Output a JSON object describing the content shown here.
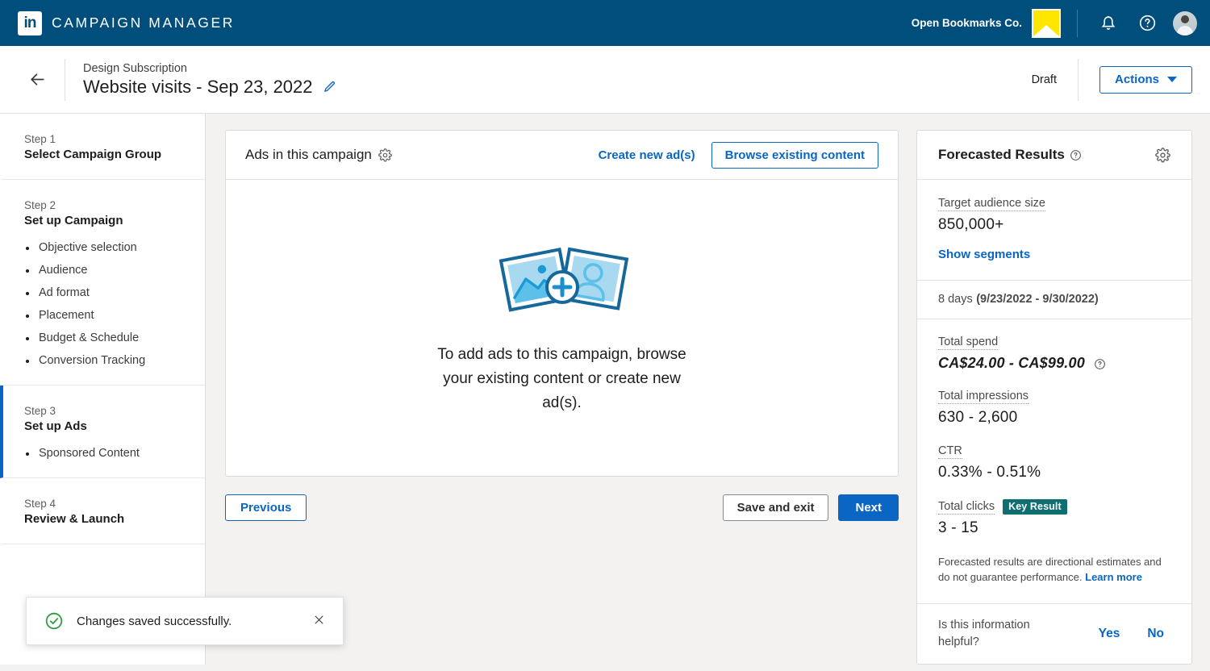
{
  "topnav": {
    "logo_text": "in",
    "brand": "CAMPAIGN MANAGER",
    "account_name": "Open Bookmarks Co.",
    "icons": {
      "notifications": "bell-icon",
      "help": "question-circle-icon",
      "avatar": "user-avatar"
    }
  },
  "subheader": {
    "back": "back-arrow",
    "group_name": "Design Subscription",
    "campaign_title": "Website visits - Sep 23, 2022",
    "edit_icon": "pencil-icon",
    "status": "Draft",
    "actions_label": "Actions"
  },
  "sidebar": {
    "steps": [
      {
        "num": "Step 1",
        "title": "Select Campaign Group",
        "active": false,
        "substeps": []
      },
      {
        "num": "Step 2",
        "title": "Set up Campaign",
        "active": false,
        "substeps": [
          "Objective selection",
          "Audience",
          "Ad format",
          "Placement",
          "Budget & Schedule",
          "Conversion Tracking"
        ]
      },
      {
        "num": "Step 3",
        "title": "Set up Ads",
        "active": true,
        "substeps": [
          "Sponsored Content"
        ]
      },
      {
        "num": "Step 4",
        "title": "Review & Launch",
        "active": false,
        "substeps": []
      }
    ]
  },
  "main": {
    "card_title": "Ads in this campaign",
    "card_gear_icon": "gear-icon",
    "create_new_ads": "Create new ad(s)",
    "browse_existing": "Browse existing content",
    "empty_state": {
      "illustration": "two-photo-cards-with-plus",
      "text": "To add ads to this campaign, browse your existing content or create new ad(s)."
    },
    "footer": {
      "previous": "Previous",
      "save_and_exit": "Save and exit",
      "next": "Next"
    }
  },
  "forecast": {
    "title": "Forecasted Results",
    "title_help_icon": "question-circle-icon",
    "settings_icon": "gear-icon",
    "audience_label": "Target audience size",
    "audience_value": "850,000+",
    "show_segments": "Show segments",
    "duration": "8 days",
    "date_range": "(9/23/2022 - 9/30/2022)",
    "metrics": [
      {
        "label": "Total spend",
        "value": "CA$24.00 - CA$99.00",
        "italic": true,
        "help": true,
        "badge": null
      },
      {
        "label": "Total impressions",
        "value": "630 - 2,600",
        "italic": false,
        "help": false,
        "badge": null
      },
      {
        "label": "CTR",
        "value": "0.33% - 0.51%",
        "italic": false,
        "help": false,
        "badge": null
      },
      {
        "label": "Total clicks",
        "value": "3 - 15",
        "italic": false,
        "help": false,
        "badge": "Key Result"
      }
    ],
    "disclaimer": "Forecasted results are directional estimates and do not guarantee performance.",
    "learn_more": "Learn more",
    "helpful_question": "Is this information helpful?",
    "yes": "Yes",
    "no": "No"
  },
  "toast": {
    "icon": "check-circle-icon",
    "message": "Changes saved successfully.",
    "close_icon": "close-icon"
  },
  "colors": {
    "header_blue": "#004e7c",
    "link_blue": "#0a66c2",
    "primary_button": "#0b66c3",
    "badge_teal": "#0e6e72",
    "success_green": "#2f9e44",
    "account_yellow": "#ffe600",
    "page_bg": "#f3f2f1"
  }
}
